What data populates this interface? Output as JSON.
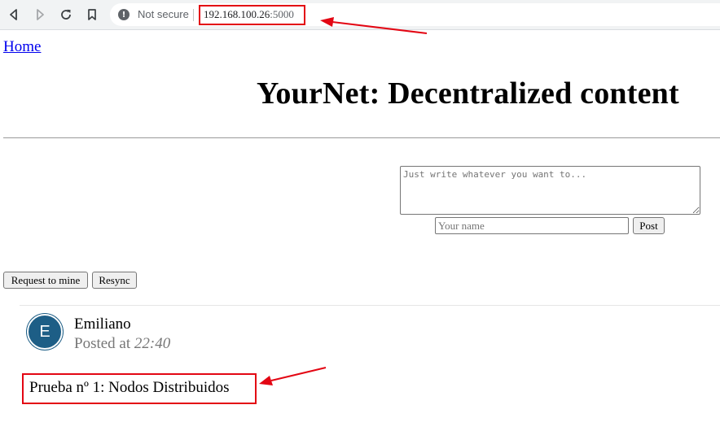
{
  "browser": {
    "not_secure_label": "Not secure",
    "url_host": "192.168.100.26",
    "url_port": ":5000",
    "info_icon_glyph": "!"
  },
  "nav": {
    "home_link": "Home"
  },
  "page": {
    "title": "YourNet: Decentralized content"
  },
  "compose": {
    "textarea_placeholder": "Just write whatever you want to...",
    "name_placeholder": "Your name",
    "post_button": "Post"
  },
  "actions": {
    "request_label": "Request to mine",
    "resync_label": "Resync"
  },
  "post": {
    "avatar_initial": "E",
    "avatar_color": "#1d5e86",
    "author": "Emiliano",
    "posted_prefix": "Posted at",
    "time": "22:40",
    "content": "Prueba nº 1: Nodos Distribuidos"
  },
  "annotations": {
    "highlight_color": "#e30613"
  },
  "icons": {
    "back": "back-arrow-icon",
    "forward": "forward-arrow-icon",
    "reload": "reload-icon",
    "bookmark": "bookmark-icon",
    "info": "info-icon"
  }
}
